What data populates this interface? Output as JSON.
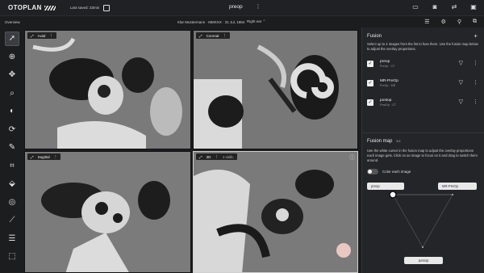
{
  "app": {
    "logo_text": "OTOPLAN",
    "last_saved": "Last saved: 33min",
    "doc_title": "preop",
    "kebab": "⋮"
  },
  "subbar": {
    "overview": "Overview",
    "patient": "Klar Mustermann · MMXXX · 31 Jul, 1984",
    "ear": "Right ear ⌃"
  },
  "viewports": {
    "axial": "Axial",
    "coronal": "Coronal",
    "sagittal": "Sagittal",
    "threed": "3D",
    "threed_extra": "1 visib."
  },
  "panel": {
    "title": "Fusion",
    "add": "+",
    "desc": "Select up to 4 images from the list to fuse them. Use the fusion map below to adjust the overlay proportions.",
    "images": [
      {
        "name": "preop",
        "sub": "PreOp · CT"
      },
      {
        "name": "MR-PreOp",
        "sub": "PreOp · MR"
      },
      {
        "name": "postop",
        "sub": "PostOp · CT"
      }
    ],
    "map_title": "Fusion map",
    "map_badge": "3/4",
    "map_desc": "Use the white cursor in the fusion map to adjust the overlay proportions each image gets. Click on an image to focus on it and drag to switch them around.",
    "color_label": "Color each image",
    "chips": {
      "top_left": "preop",
      "top_right": "MR-PreOp",
      "bottom": "postop"
    }
  },
  "colors": {
    "bg": "#1c1d1f",
    "panel": "#242528",
    "accent": "#ffffff"
  }
}
